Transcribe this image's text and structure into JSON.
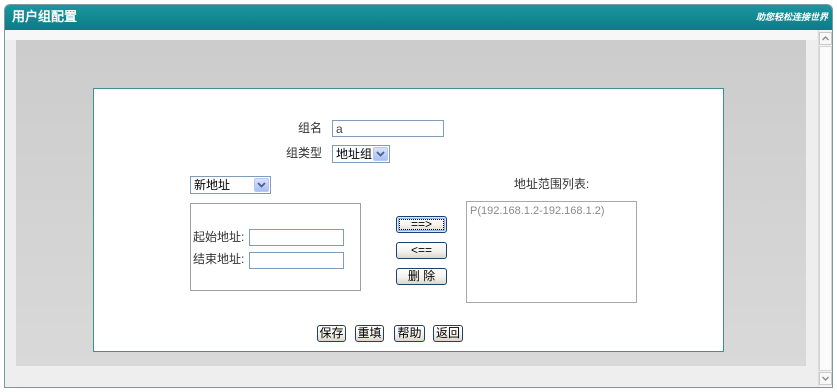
{
  "window": {
    "title": "用户组配置",
    "logo_text": "助您轻松连接世界"
  },
  "form": {
    "group_name": {
      "label": "组名",
      "value": "a"
    },
    "group_type": {
      "label": "组类型",
      "value": "地址组"
    },
    "address_mode": {
      "value": "新地址"
    },
    "address_list": {
      "label": "地址范围列表:",
      "items": [
        "P(192.168.1.2-192.168.1.2)"
      ]
    },
    "start_address": {
      "label": "起始地址:",
      "value": ""
    },
    "end_address": {
      "label": "结束地址:",
      "value": ""
    },
    "buttons": {
      "add": "==>",
      "remove": "<==",
      "delete": "删 除"
    }
  },
  "actions": {
    "save": "保存",
    "reset": "重填",
    "help": "帮助",
    "back": "返回"
  },
  "icons": {
    "select_arrow": "chevron-down-icon",
    "scroll_up": "scroll-up-arrow-icon",
    "scroll_down": "scroll-down-arrow-icon"
  },
  "colors": {
    "title_bar": "#0f858e",
    "panel_border": "#3f8f96",
    "button_border": "#1d3f72"
  }
}
